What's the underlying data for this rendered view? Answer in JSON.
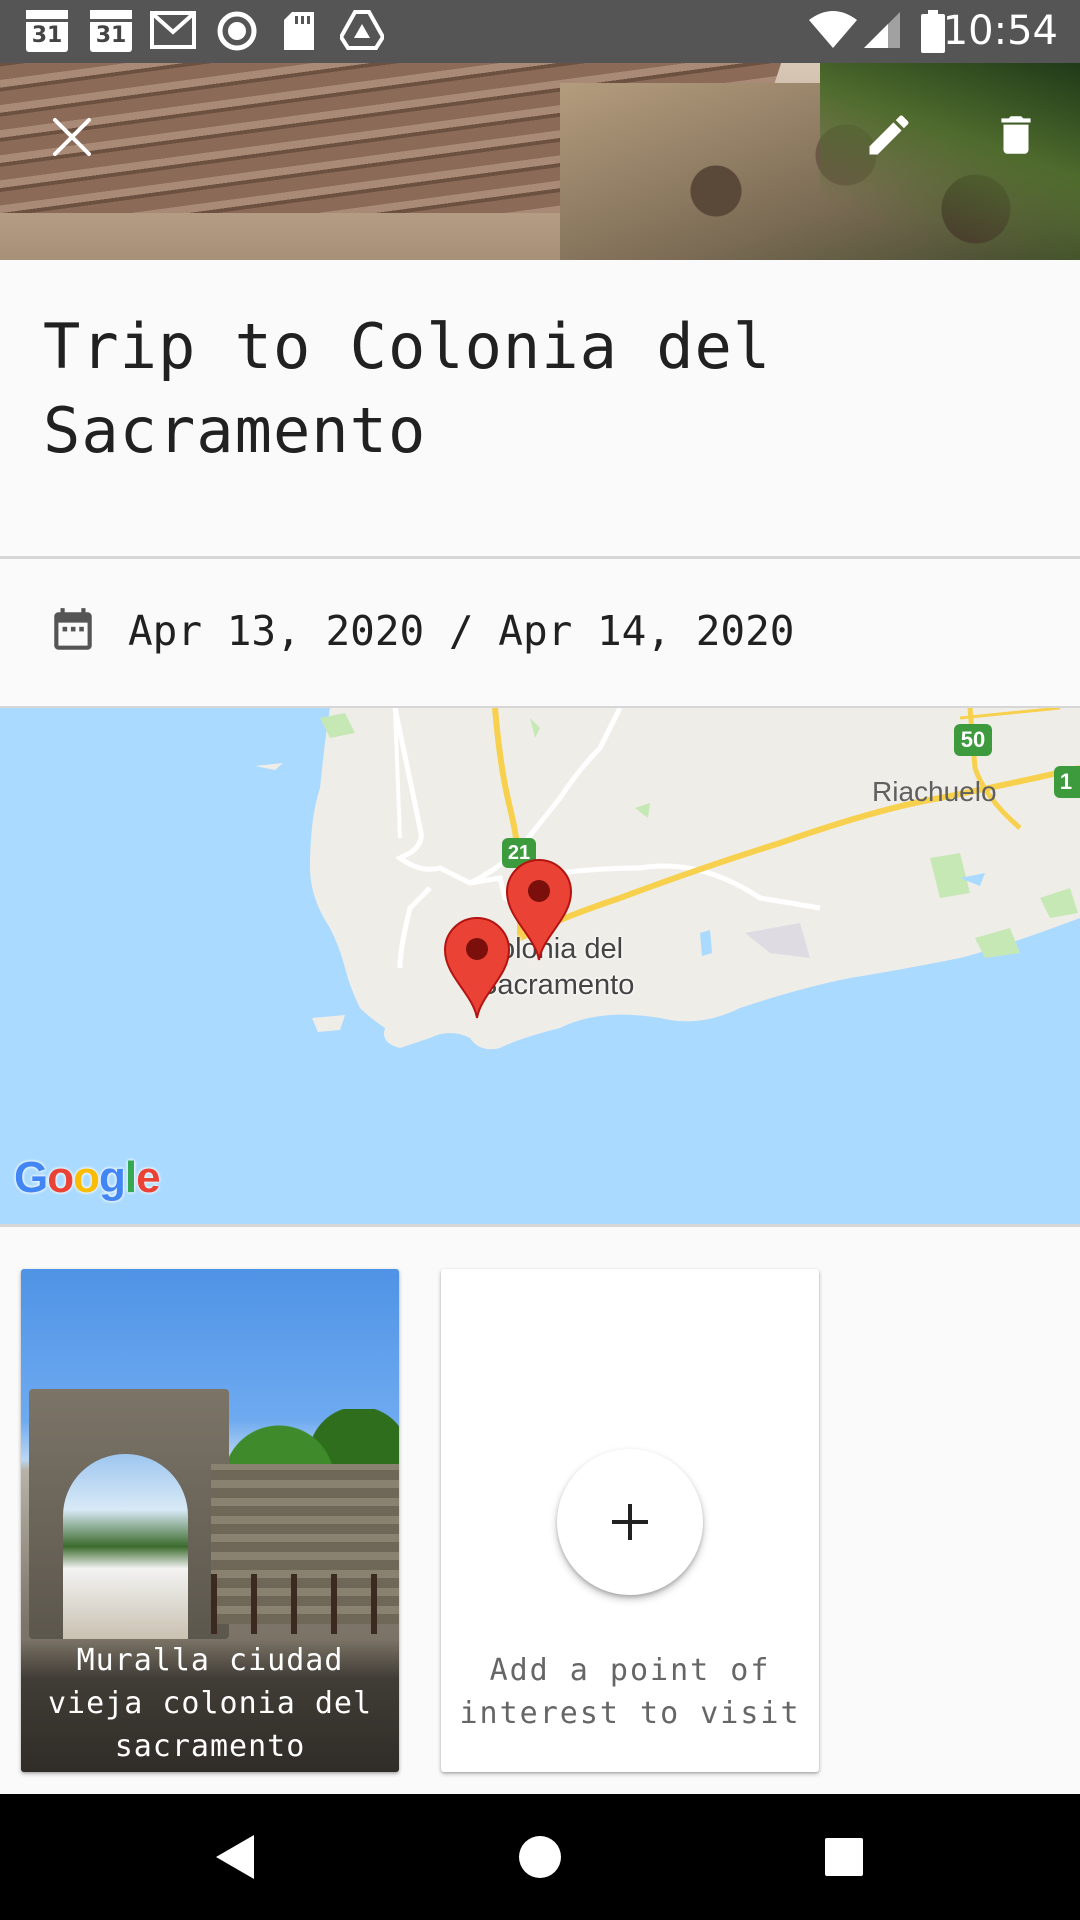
{
  "status_bar": {
    "time": "10:54",
    "calendar_day_1": "31",
    "calendar_day_2": "31",
    "icons": [
      "calendar-icon",
      "calendar-icon",
      "gmail-icon",
      "record-icon",
      "sd-card-icon",
      "drive-icon",
      "wifi-icon",
      "cell-signal-icon",
      "battery-icon"
    ]
  },
  "header": {
    "close_icon": "close-icon",
    "edit_icon": "edit-icon",
    "delete_icon": "delete-icon"
  },
  "trip": {
    "title": "Trip to Colonia del Sacramento",
    "dates": "Apr 13, 2020 / Apr 14, 2020",
    "date_icon": "calendar-icon"
  },
  "map": {
    "place_label_1": "Riachuelo",
    "city_label_line1": "Colonia del",
    "city_label_line2": "Sacramento",
    "road_shield_1": "50",
    "road_shield_2": "21",
    "road_shield_3": "1",
    "logo_letters": [
      "G",
      "o",
      "o",
      "g",
      "l",
      "e"
    ],
    "water_color": "#aadaff",
    "land_color": "#efede8",
    "marker_color": "#ea4335"
  },
  "points_of_interest": [
    {
      "name": "Muralla ciudad vieja colonia del sacramento"
    }
  ],
  "add_poi": {
    "label": "Add a point of interest to visit",
    "icon": "plus-icon"
  },
  "nav_bar": {
    "icons": [
      "back-icon",
      "home-icon",
      "recents-icon"
    ]
  }
}
